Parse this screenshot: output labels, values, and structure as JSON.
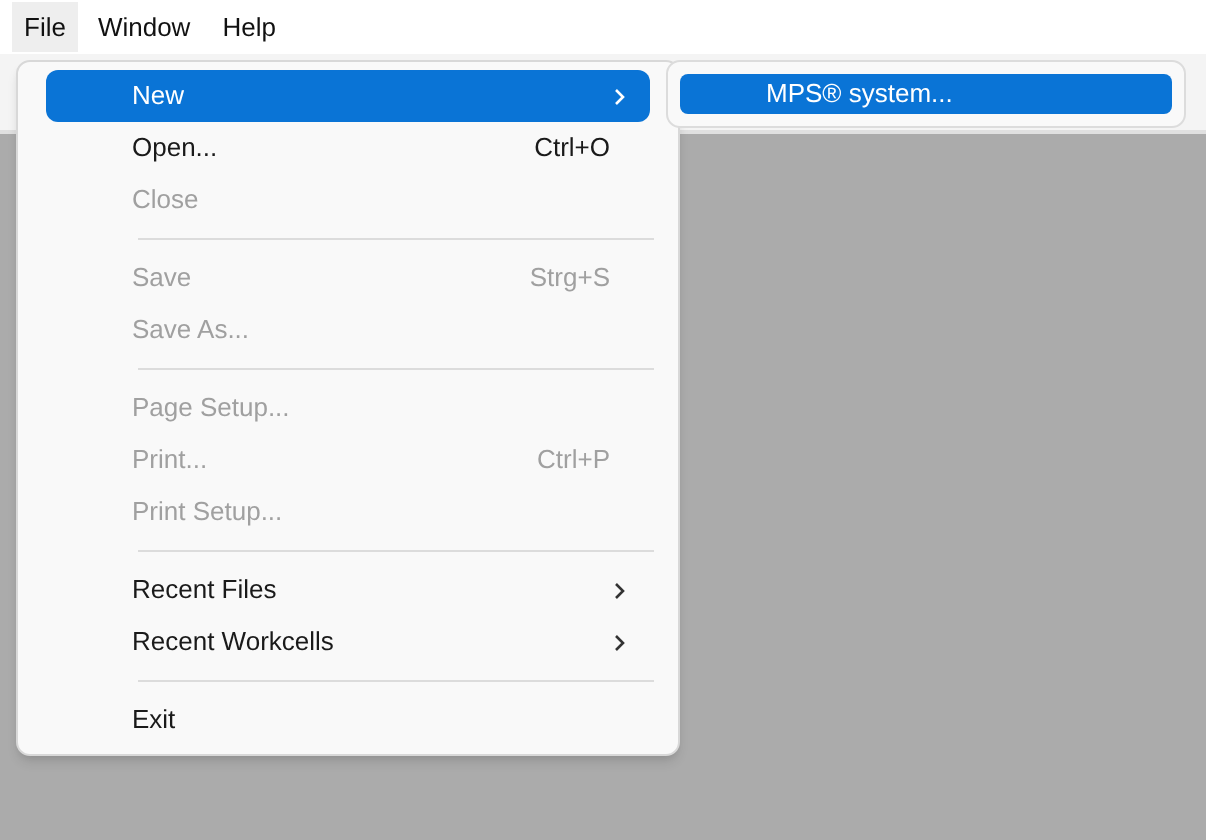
{
  "menubar": [
    {
      "label": "File",
      "selected": true
    },
    {
      "label": "Window",
      "selected": false
    },
    {
      "label": "Help",
      "selected": false
    }
  ],
  "file_menu": [
    {
      "kind": "item",
      "label": "New",
      "selected": true,
      "disabled": false,
      "submenu": true
    },
    {
      "kind": "item",
      "label": "Open...",
      "shortcut": "Ctrl+O",
      "selected": false,
      "disabled": false,
      "submenu": false
    },
    {
      "kind": "item",
      "label": "Close",
      "selected": false,
      "disabled": true,
      "submenu": false
    },
    {
      "kind": "separator"
    },
    {
      "kind": "item",
      "label": "Save",
      "shortcut": "Strg+S",
      "selected": false,
      "disabled": true,
      "submenu": false
    },
    {
      "kind": "item",
      "label": "Save As...",
      "selected": false,
      "disabled": true,
      "submenu": false
    },
    {
      "kind": "separator"
    },
    {
      "kind": "item",
      "label": "Page Setup...",
      "selected": false,
      "disabled": true,
      "submenu": false
    },
    {
      "kind": "item",
      "label": "Print...",
      "shortcut": "Ctrl+P",
      "selected": false,
      "disabled": true,
      "submenu": false
    },
    {
      "kind": "item",
      "label": "Print Setup...",
      "selected": false,
      "disabled": true,
      "submenu": false
    },
    {
      "kind": "separator"
    },
    {
      "kind": "item",
      "label": "Recent Files",
      "selected": false,
      "disabled": false,
      "submenu": true
    },
    {
      "kind": "item",
      "label": "Recent Workcells",
      "selected": false,
      "disabled": false,
      "submenu": true
    },
    {
      "kind": "separator"
    },
    {
      "kind": "item",
      "label": "Exit",
      "selected": false,
      "disabled": false,
      "submenu": false
    }
  ],
  "new_submenu": [
    {
      "label": "MPS® system...",
      "selected": true
    }
  ]
}
